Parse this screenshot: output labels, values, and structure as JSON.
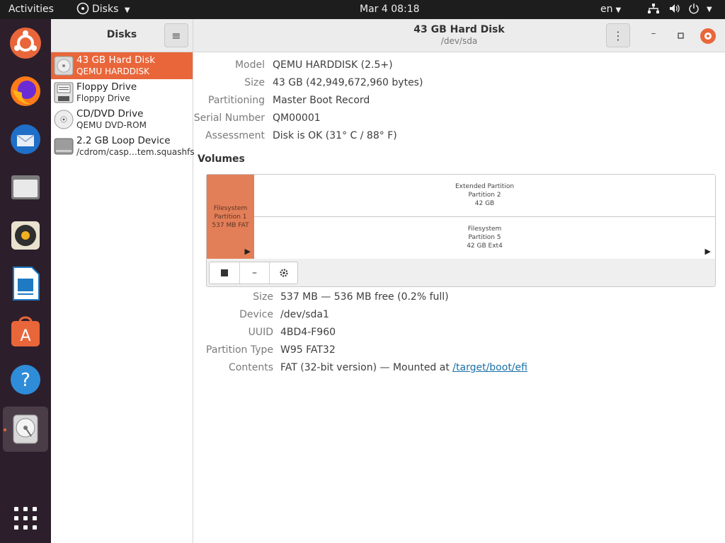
{
  "topbar": {
    "activities": "Activities",
    "app_menu": "Disks",
    "clock": "Mar 4  08:18",
    "lang": "en"
  },
  "window": {
    "sidebar_title": "Disks",
    "title": "43 GB Hard Disk",
    "subtitle": "/dev/sda"
  },
  "devices": [
    {
      "name": "43 GB Hard Disk",
      "sub": "QEMU HARDDISK",
      "icon": "hard-disk-icon"
    },
    {
      "name": "Floppy Drive",
      "sub": "Floppy Drive",
      "icon": "floppy-icon"
    },
    {
      "name": "CD/DVD Drive",
      "sub": "QEMU DVD-ROM",
      "icon": "optical-drive-icon"
    },
    {
      "name": "2.2 GB Loop Device",
      "sub": "/cdrom/casp…tem.squashfs",
      "icon": "loop-device-icon"
    }
  ],
  "disk_info": {
    "model_label": "Model",
    "model": "QEMU HARDDISK (2.5+)",
    "size_label": "Size",
    "size": "43 GB (42,949,672,960 bytes)",
    "partitioning_label": "Partitioning",
    "partitioning": "Master Boot Record",
    "serial_label": "Serial Number",
    "serial": "QM00001",
    "assessment_label": "Assessment",
    "assessment": "Disk is OK (31° C / 88° F)"
  },
  "volumes": {
    "heading": "Volumes",
    "p1": {
      "line1": "Filesystem",
      "line2": "Partition 1",
      "line3": "537 MB FAT"
    },
    "ext": {
      "line1": "Extended Partition",
      "line2": "Partition 2",
      "line3": "42 GB"
    },
    "p5": {
      "line1": "Filesystem",
      "line2": "Partition 5",
      "line3": "42 GB Ext4"
    }
  },
  "partition_info": {
    "size_label": "Size",
    "size": "537 MB — 536 MB free (0.2% full)",
    "device_label": "Device",
    "device": "/dev/sda1",
    "uuid_label": "UUID",
    "uuid": "4BD4-F960",
    "type_label": "Partition Type",
    "type": "W95 FAT32",
    "contents_label": "Contents",
    "contents_prefix": "FAT (32-bit version) — Mounted at ",
    "contents_link": "/target/boot/efi"
  },
  "colors": {
    "accent": "#e9663a",
    "dock": "#2c1f2b",
    "topbar": "#1d1d1d",
    "link": "#1a6fa8"
  }
}
